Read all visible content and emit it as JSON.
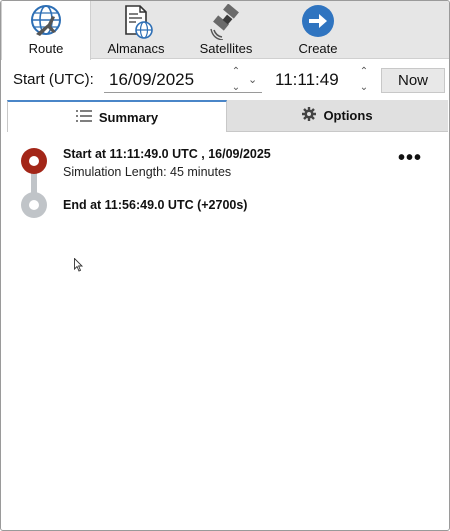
{
  "nav": {
    "items": [
      {
        "label": "Route",
        "icon": "plane-globe-icon",
        "active": true
      },
      {
        "label": "Almanacs",
        "icon": "document-globe-icon",
        "active": false
      },
      {
        "label": "Satellites",
        "icon": "satellite-icon",
        "active": false
      },
      {
        "label": "Create",
        "icon": "arrow-right-circle-icon",
        "active": false
      }
    ]
  },
  "time": {
    "start_label": "Start (UTC):",
    "date_value": "16/09/2025",
    "time_value": "11:11:49",
    "now_label": "Now"
  },
  "tabs": {
    "summary": "Summary",
    "options": "Options"
  },
  "route": {
    "start_title": "Start at 11:11:49.0 UTC , 16/09/2025",
    "start_sub": "Simulation Length: 45 minutes",
    "end_title": "End at 11:56:49.0 UTC (+2700s)",
    "more": "•••"
  },
  "colors": {
    "accent": "#4a86c8",
    "start_node": "#a32618",
    "end_node": "#c0c4c8"
  }
}
